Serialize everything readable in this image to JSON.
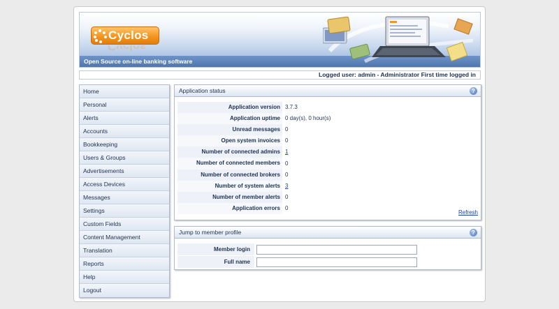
{
  "brand": {
    "logo_text": "Cyclos",
    "tagline": "Open Source on-line banking software"
  },
  "userbar": {
    "text": "Logged user: admin - Administrator  First time logged in"
  },
  "sidebar": {
    "items": [
      {
        "label": "Home"
      },
      {
        "label": "Personal"
      },
      {
        "label": "Alerts"
      },
      {
        "label": "Accounts"
      },
      {
        "label": "Bookkeeping"
      },
      {
        "label": "Users & Groups"
      },
      {
        "label": "Advertisements"
      },
      {
        "label": "Access Devices"
      },
      {
        "label": "Messages"
      },
      {
        "label": "Settings"
      },
      {
        "label": "Custom Fields"
      },
      {
        "label": "Content Management"
      },
      {
        "label": "Translation"
      },
      {
        "label": "Reports"
      },
      {
        "label": "Help"
      },
      {
        "label": "Logout"
      }
    ]
  },
  "status_panel": {
    "title": "Application status",
    "rows": [
      {
        "label": "Application version",
        "value": "3.7.3",
        "link": false
      },
      {
        "label": "Application uptime",
        "value": "0 day(s), 0 hour(s)",
        "link": false
      },
      {
        "label": "Unread messages",
        "value": "0",
        "link": false
      },
      {
        "label": "Open system invoices",
        "value": "0",
        "link": false
      },
      {
        "label": "Number of connected admins",
        "value": "1",
        "link": true
      },
      {
        "label": "Number of connected members",
        "value": "0",
        "link": false
      },
      {
        "label": "Number of connected brokers",
        "value": "0",
        "link": false
      },
      {
        "label": "Number of system alerts",
        "value": "3",
        "link": true
      },
      {
        "label": "Number of member alerts",
        "value": "0",
        "link": false
      },
      {
        "label": "Application errors",
        "value": "0",
        "link": false
      }
    ],
    "refresh_label": "Refresh"
  },
  "jump_panel": {
    "title": "Jump to member profile",
    "member_login_label": "Member login",
    "member_login_value": "",
    "full_name_label": "Full name",
    "full_name_value": ""
  },
  "colors": {
    "accent": "#f4951f",
    "link": "#1c3fa8",
    "text": "#1f3150",
    "banner_band": "#4f76b0"
  },
  "icons": {
    "help": "help-icon",
    "logo": "cyclos-logo-icon"
  }
}
